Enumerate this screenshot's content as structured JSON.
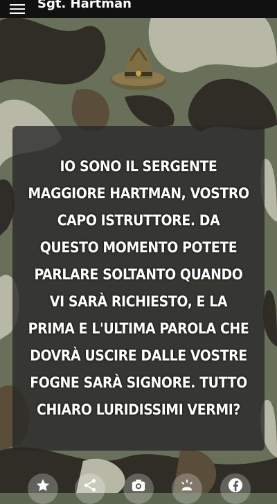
{
  "app": {
    "title": "Sgt. Hartman"
  },
  "quote": {
    "text": "IO SONO IL SERGENTE MAGGIORE HARTMAN, VOSTRO CAPO ISTRUTTORE. DA QUESTO MOMENTO POTETE PARLARE SOLTANTO QUANDO VI SARÀ RICHIESTO, E LA PRIMA E L'ULTIMA PAROLA CHE DOVRÀ USCIRE DALLE VOSTRE FOGNE SARÀ SIGNORE. TUTTO CHIARO LURIDISSIMI VERMI?"
  },
  "bottom_actions": [
    {
      "icon": "star-icon"
    },
    {
      "icon": "share-icon"
    },
    {
      "icon": "camera-icon"
    },
    {
      "icon": "light-icon"
    },
    {
      "icon": "facebook-icon"
    }
  ],
  "colors": {
    "app_bar": "#111111",
    "card": "#282828",
    "camo_dark": "#2f2d26",
    "camo_olive": "#6b7258",
    "camo_light": "#b7b9a6",
    "camo_brown": "#5a4d3a"
  }
}
